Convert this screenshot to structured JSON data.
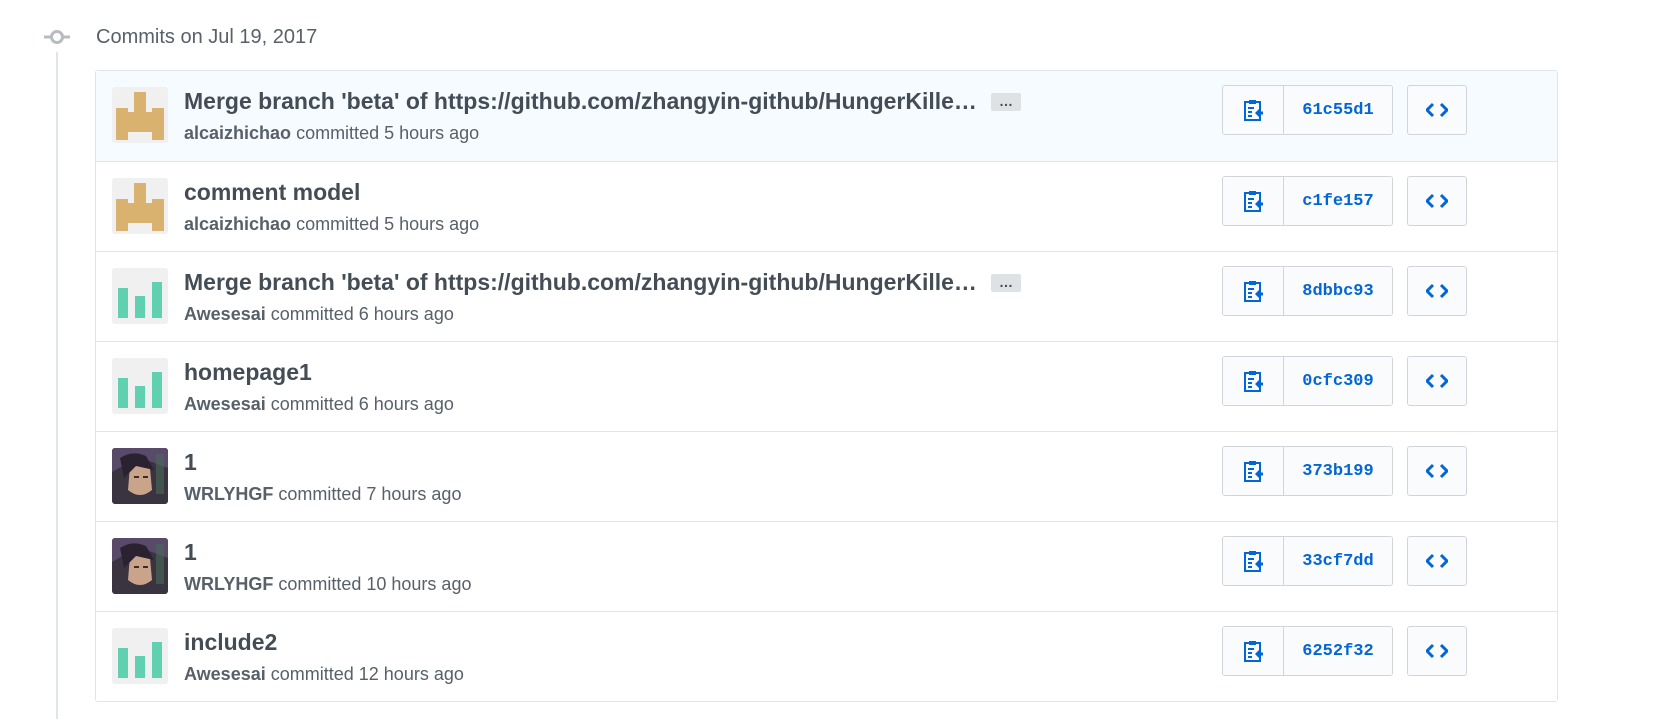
{
  "group": {
    "title": "Commits on Jul 19, 2017"
  },
  "colors": {
    "link": "#0366d6",
    "avatar_tan": "#d9b26f",
    "avatar_teal": "#5fd1b0"
  },
  "commits": [
    {
      "message": "Merge branch 'beta' of https://github.com/zhangyin-github/HungerKille…",
      "has_expander": true,
      "expander_label": "…",
      "author": "alcaizhichao",
      "meta": "committed 5 hours ago",
      "sha": "61c55d1",
      "avatar": "tan-identicon"
    },
    {
      "message": "comment model",
      "has_expander": false,
      "expander_label": "",
      "author": "alcaizhichao",
      "meta": "committed 5 hours ago",
      "sha": "c1fe157",
      "avatar": "tan-identicon"
    },
    {
      "message": "Merge branch 'beta' of https://github.com/zhangyin-github/HungerKille…",
      "has_expander": true,
      "expander_label": "…",
      "author": "Awesesai",
      "meta": "committed 6 hours ago",
      "sha": "8dbbc93",
      "avatar": "teal-identicon"
    },
    {
      "message": "homepage1",
      "has_expander": false,
      "expander_label": "",
      "author": "Awesesai",
      "meta": "committed 6 hours ago",
      "sha": "0cfc309",
      "avatar": "teal-identicon"
    },
    {
      "message": "1",
      "has_expander": false,
      "expander_label": "",
      "author": "WRLYHGF",
      "meta": "committed 7 hours ago",
      "sha": "373b199",
      "avatar": "photo"
    },
    {
      "message": "1",
      "has_expander": false,
      "expander_label": "",
      "author": "WRLYHGF",
      "meta": "committed 10 hours ago",
      "sha": "33cf7dd",
      "avatar": "photo"
    },
    {
      "message": "include2",
      "has_expander": false,
      "expander_label": "",
      "author": "Awesesai",
      "meta": "committed 12 hours ago",
      "sha": "6252f32",
      "avatar": "teal-identicon"
    }
  ]
}
